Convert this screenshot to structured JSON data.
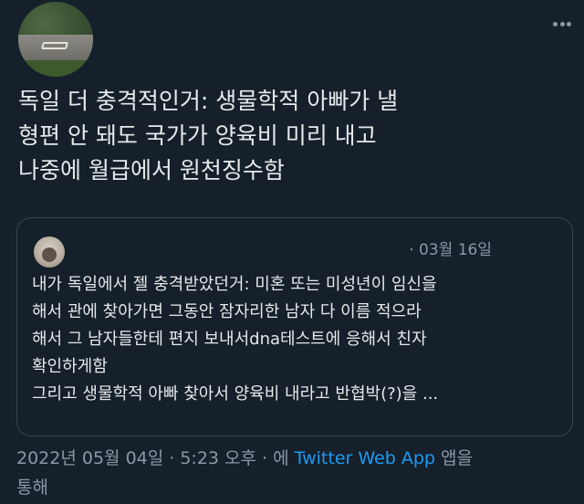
{
  "tweet": {
    "text_lines": [
      "독일 더 충격적인거: 생물학적 아빠가 낼",
      "형편 안 돼도 국가가 양육비 미리 내고",
      "나중에 월급에서 원천징수함"
    ]
  },
  "quote": {
    "date": "· 03월 16일",
    "text_lines": [
      "내가 독일에서 젤 충격받았던거: 미혼 또는 미성년이 임신을",
      "해서 관에 찾아가면 그동안 잠자리한 남자 다 이름 적으라",
      "해서 그 남자들한테 편지 보내서dna테스트에 응해서 친자",
      "확인하게함",
      "그리고 생물학적 아빠 찾아서 양육비 내라고 반협박(?)을 ..."
    ]
  },
  "meta": {
    "datetime": "2022년 05월 04일 · 5:23 오후 · 에 ",
    "app_name": "Twitter Web App",
    "suffix": " 앱을",
    "line2": "통해"
  },
  "colors": {
    "background": "#15202b",
    "text": "#e7e9ea",
    "secondary": "#8b98a5",
    "link": "#1d9bf0",
    "border": "#38444d"
  }
}
